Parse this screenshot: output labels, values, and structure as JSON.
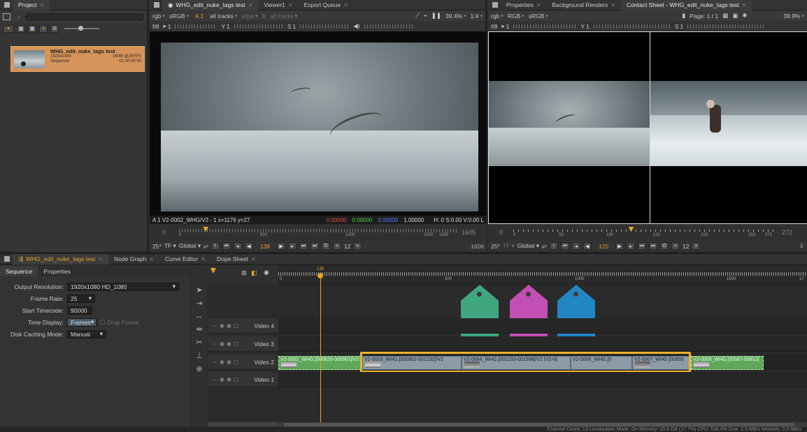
{
  "colors": {
    "accent_orange": "#d69a2a",
    "tag_green": "#3fa67f",
    "tag_magenta": "#c24fb3",
    "tag_blue": "#2286c4",
    "clip_grey": "#8c9ba8",
    "clip_green": "#5fa85a",
    "playhead": "#e8a32b"
  },
  "project_panel": {
    "tab_label": "Project",
    "item": {
      "name": "WHG_edit_nuke_tags test",
      "resolution": "1920x1080",
      "kind": "Sequence",
      "frames": "1606f @25FPS",
      "timecode": "01:00:00:00"
    }
  },
  "viewer_panel": {
    "tabs": [
      {
        "label": "WHG_edit_nuke_tags test",
        "active": true
      },
      {
        "label": "Viewer1",
        "active": false
      },
      {
        "label": "Export Queue",
        "active": false
      }
    ],
    "toolbar": {
      "channels": "rgb",
      "colorspace": "sRGB",
      "input_a": "A 1",
      "tracks_a": "all tracks",
      "wipe": "wipe",
      "input_b": "B",
      "tracks_b": "all tracks",
      "zoom": "39.4%",
      "ratio": "1:4"
    },
    "toolbar2": {
      "fstop": "f/8",
      "step": "1",
      "gamma_label": "Y",
      "gamma": "1",
      "saturation_label": "S",
      "saturation": "1"
    },
    "status": {
      "clip": "A 1 V2-0002_WHG/V2 - 1 x=1176 y=27",
      "r": "0.00000",
      "g": "0.00000",
      "b": "0.00000",
      "a": "1.00000",
      "hv": "H: 0 S:0.00 V:0.00 L"
    },
    "scrub": {
      "start": "0",
      "end": "1605",
      "ticks": [
        "0",
        "500",
        "1000",
        "1500",
        "1605"
      ],
      "playhead_fraction": 0.086
    },
    "controls": {
      "fps": "25*",
      "tf": "TF",
      "global": "Global",
      "frame": "138",
      "step": "12",
      "end_frame": "1606"
    }
  },
  "right_panel": {
    "tabs": [
      {
        "label": "Properties",
        "active": false
      },
      {
        "label": "Background Renders",
        "active": false
      },
      {
        "label": "Contact Sheet - WHG_edit_nuke_tags test",
        "active": true
      }
    ],
    "toolbar": {
      "channels": "rgb",
      "colorspace_model": "RGB",
      "colorspace": "sRGB",
      "page": "Page: 1 / 1",
      "zoom": "39.9%"
    },
    "toolbar2": {
      "fstop": "f/8",
      "step": "1",
      "gamma_label": "Y",
      "gamma": "1",
      "saturation_label": "S",
      "saturation": "1"
    },
    "scrub": {
      "start": "0",
      "end": "272",
      "ticks": [
        "0",
        "50",
        "100",
        "150",
        "200",
        "250",
        "272"
      ],
      "playhead_fraction": 0.44
    },
    "controls": {
      "fps": "25*",
      "tf": "TF",
      "global": "Global",
      "frame": "120",
      "step": "12"
    }
  },
  "bottom_panel": {
    "tabs": [
      {
        "label": "WHG_edit_nuke_tags test",
        "active": true
      },
      {
        "label": "Node Graph",
        "active": false
      },
      {
        "label": "Curve Editor",
        "active": false
      },
      {
        "label": "Dope Sheet",
        "active": false
      }
    ],
    "subtabs": [
      "Sequence",
      "Properties"
    ],
    "properties": {
      "output_resolution_label": "Output Resolution:",
      "output_resolution": "1920x1080 HD_1080",
      "frame_rate_label": "Frame Rate:",
      "frame_rate": "25",
      "start_timecode_label": "Start Timecode:",
      "start_timecode": "90000",
      "time_display_label": "Time Display:",
      "time_display": "Frames",
      "drop_frame": "Drop Frame",
      "disk_caching_label": "Disk Caching Mode:",
      "disk_caching": "Manual"
    },
    "ruler": {
      "ticks": [
        "0",
        "500",
        "1000",
        "1500",
        "17"
      ],
      "playhead_label": "138"
    },
    "tracks": [
      "Video 4",
      "Video 3",
      "Video 2",
      "Video 1"
    ],
    "clips": [
      {
        "label": "V2-0002_WHG.[000629-000901]/V2",
        "style": "green"
      },
      {
        "label": "V2-0003_WHG.[000902-001232]/V2",
        "style": "grey"
      },
      {
        "label": "V2-0004_WHG.[001233-001598]/V2 (V2-0(",
        "style": "grey"
      },
      {
        "label": "V2-0006_WHG.[0",
        "style": "grey"
      },
      {
        "label": "V2-0007_WHG.[00550",
        "style": "grey"
      },
      {
        "label": "V2-0009_WHG.[00587-00812]",
        "style": "green"
      }
    ],
    "status_bar": "Channel Count: 13 Localization Mode: On Memory: 15.6 GB (17.7%) CPU: 538.4% Disk: 2.5 MB/s Network: 0.0 MB/s"
  }
}
